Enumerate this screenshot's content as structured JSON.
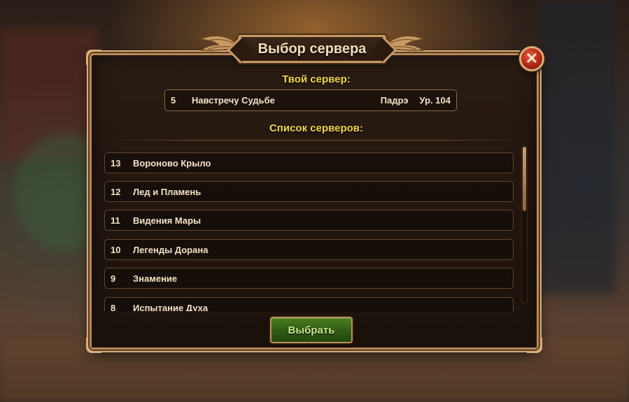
{
  "dialog": {
    "title": "Выбор сервера",
    "your_server_heading": "Твой сервер:",
    "server_list_heading": "Список серверов:",
    "close_icon": "close-x-icon",
    "select_label": "Выбрать"
  },
  "current_server": {
    "number": "5",
    "name": "Навстречу Судьбе",
    "player": "Падрэ",
    "level": "Ур. 104"
  },
  "servers": [
    {
      "number": "13",
      "name": "Вороново Крыло"
    },
    {
      "number": "12",
      "name": "Лед и Пламень"
    },
    {
      "number": "11",
      "name": "Видения Мары"
    },
    {
      "number": "10",
      "name": "Легенды Дорана"
    },
    {
      "number": "9",
      "name": "Знамение"
    },
    {
      "number": "8",
      "name": "Испытание Духа"
    }
  ],
  "colors": {
    "heading": "#f2d64a",
    "frame": "#c99a63",
    "button": "#2f5a14",
    "close": "#b22616"
  }
}
